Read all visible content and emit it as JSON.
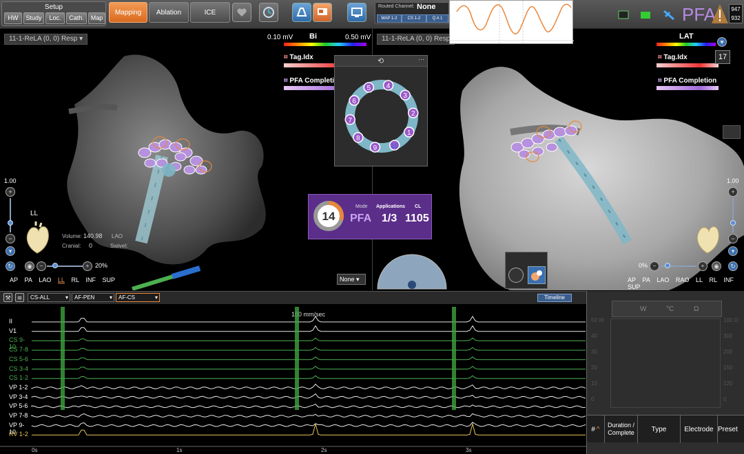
{
  "toolbar": {
    "setup_title": "Setup",
    "setup_buttons": [
      "HW",
      "Study",
      "Loc.",
      "Cath.",
      "Map"
    ],
    "tabs": [
      "Mapping",
      "Ablation",
      "ICE"
    ],
    "active_tab": "Mapping",
    "routed_channel_label": "Routed Channel:",
    "routed_channel_value": "None",
    "map_buttons": [
      "MAP 1-2",
      "CS 1-2",
      "Q A 1"
    ],
    "app_logo": "PFA",
    "counts": [
      "947",
      "932"
    ]
  },
  "left_view": {
    "title": "11-1-ReLA (0, 0) Resp",
    "scale_min": "0.10 mV",
    "scale_max": "0.50 mV",
    "scale_name": "Bi",
    "tag_index_label": "Tag.Idx",
    "pfa_completion_label": "PFA Completion",
    "zoom_level": "1.00",
    "orientation_label": "LL",
    "volume_label": "Volume:",
    "volume_value": "140.98",
    "cranial_label": "Cranial:",
    "cranial_value": "0",
    "lao_label": "LAO",
    "swivel_label": "Swivel:",
    "zoom_percent": "20%",
    "orientations": [
      "AP",
      "PA",
      "LAO",
      "LL",
      "RL",
      "INF",
      "SUP"
    ],
    "selected_orientation": "LL"
  },
  "right_view": {
    "title": "11-1-ReLA (0, 0) Resp",
    "scale_name": "LAT",
    "tag_index_label": "Tag.Idx",
    "pfa_completion_label": "PFA Completion",
    "zoom_level": "1.00",
    "tag_count": "17",
    "zoom_percent": "0%",
    "orientations": [
      "AP",
      "PA",
      "LAO",
      "RAO",
      "LL",
      "RL",
      "INF",
      "SUP"
    ]
  },
  "ring_catheter": {
    "electrodes": [
      "1",
      "2",
      "3",
      "4",
      "5",
      "6",
      "7",
      "8",
      "9",
      "10"
    ]
  },
  "pfa_panel": {
    "count": "14",
    "mode_label": "Mode",
    "mode_value": "PFA",
    "applications_label": "Applications",
    "applications_value": "1/3",
    "cl_label": "CL",
    "cl_value": "1105",
    "progress_fraction": 0.3
  },
  "none_dropdown": "None",
  "egm": {
    "selectors": [
      "CS-ALL",
      "AF-PEN",
      "AF-CS"
    ],
    "timeline_label": "Timeline",
    "sweep_speed": "100 mm/sec",
    "channels": [
      {
        "label": "II",
        "color": "white"
      },
      {
        "label": "V1",
        "color": "white"
      },
      {
        "label": "CS 9-10",
        "color": "green"
      },
      {
        "label": "CS 7-8",
        "color": "green"
      },
      {
        "label": "CS 5-6",
        "color": "green"
      },
      {
        "label": "CS 3-4",
        "color": "green"
      },
      {
        "label": "CS 1-2",
        "color": "green"
      },
      {
        "label": "VP 1-2",
        "color": "white"
      },
      {
        "label": "VP 3-4",
        "color": "white"
      },
      {
        "label": "VP 5-6",
        "color": "white"
      },
      {
        "label": "VP 7-8",
        "color": "white"
      },
      {
        "label": "VP 9-10",
        "color": "white"
      },
      {
        "label": "RV 1-2",
        "color": "yellow"
      }
    ],
    "time_ticks": [
      "0s",
      "1s",
      "2s",
      "3s"
    ]
  },
  "generator_panel": {
    "header_units": [
      "W",
      "°C",
      "Ω"
    ],
    "left_axis": [
      "50 W",
      "40",
      "30",
      "20",
      "10",
      "0"
    ],
    "right_axis": [
      "100 Ω",
      "300",
      "200",
      "150",
      "120",
      "0"
    ],
    "table_headers": [
      "#",
      "Duration / Complete",
      "Type",
      "Electrode",
      "Preset"
    ]
  },
  "colors": {
    "accent": "#e8873c",
    "pfa_purple": "#5b2e8a",
    "ring_blue": "#7fb6c8",
    "egm_green": "#4caf50"
  }
}
